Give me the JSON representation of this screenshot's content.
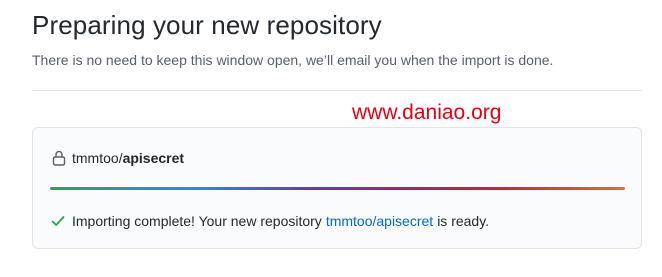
{
  "header": {
    "title": "Preparing your new repository",
    "subtitle": "There is no need to keep this window open, we’ll email you when the import is done."
  },
  "watermark": "www.daniao.org",
  "repo": {
    "owner": "tmmtoo",
    "separator": "/",
    "name": "apisecret",
    "lock_icon": "lock-icon"
  },
  "progress": {
    "percent": 100
  },
  "status": {
    "icon": "check-icon",
    "prefix": "Importing complete! Your new repository",
    "link": "tmmtoo/apisecret",
    "suffix": "is ready."
  },
  "colors": {
    "link": "#0366d6",
    "check": "#28a745",
    "watermark": "#e60012"
  }
}
